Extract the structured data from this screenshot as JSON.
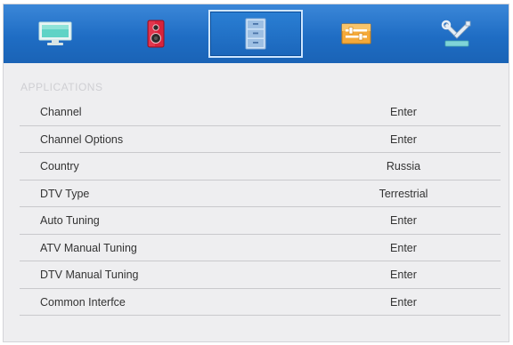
{
  "tabs": [
    {
      "icon": "monitor-icon",
      "active": false
    },
    {
      "icon": "speaker-icon",
      "active": false
    },
    {
      "icon": "cabinet-icon",
      "active": true
    },
    {
      "icon": "adjust-sliders-icon",
      "active": false
    },
    {
      "icon": "tools-icon",
      "active": false
    }
  ],
  "section": {
    "title": "APPLICATIONS"
  },
  "menu": {
    "items": [
      {
        "label": "Channel",
        "value": "Enter"
      },
      {
        "label": "Channel Options",
        "value": "Enter"
      },
      {
        "label": "Country",
        "value": "Russia"
      },
      {
        "label": "DTV Type",
        "value": "Terrestrial"
      },
      {
        "label": "Auto Tuning",
        "value": "Enter"
      },
      {
        "label": "ATV Manual Tuning",
        "value": "Enter"
      },
      {
        "label": "DTV Manual Tuning",
        "value": "Enter"
      },
      {
        "label": "Common Interfce",
        "value": "Enter"
      }
    ]
  },
  "colors": {
    "tabbar": "#1f6fc6",
    "panel": "#eeeef0",
    "text": "#333333",
    "divider": "#c9c9cc",
    "section_title": "#cfcfd3"
  }
}
